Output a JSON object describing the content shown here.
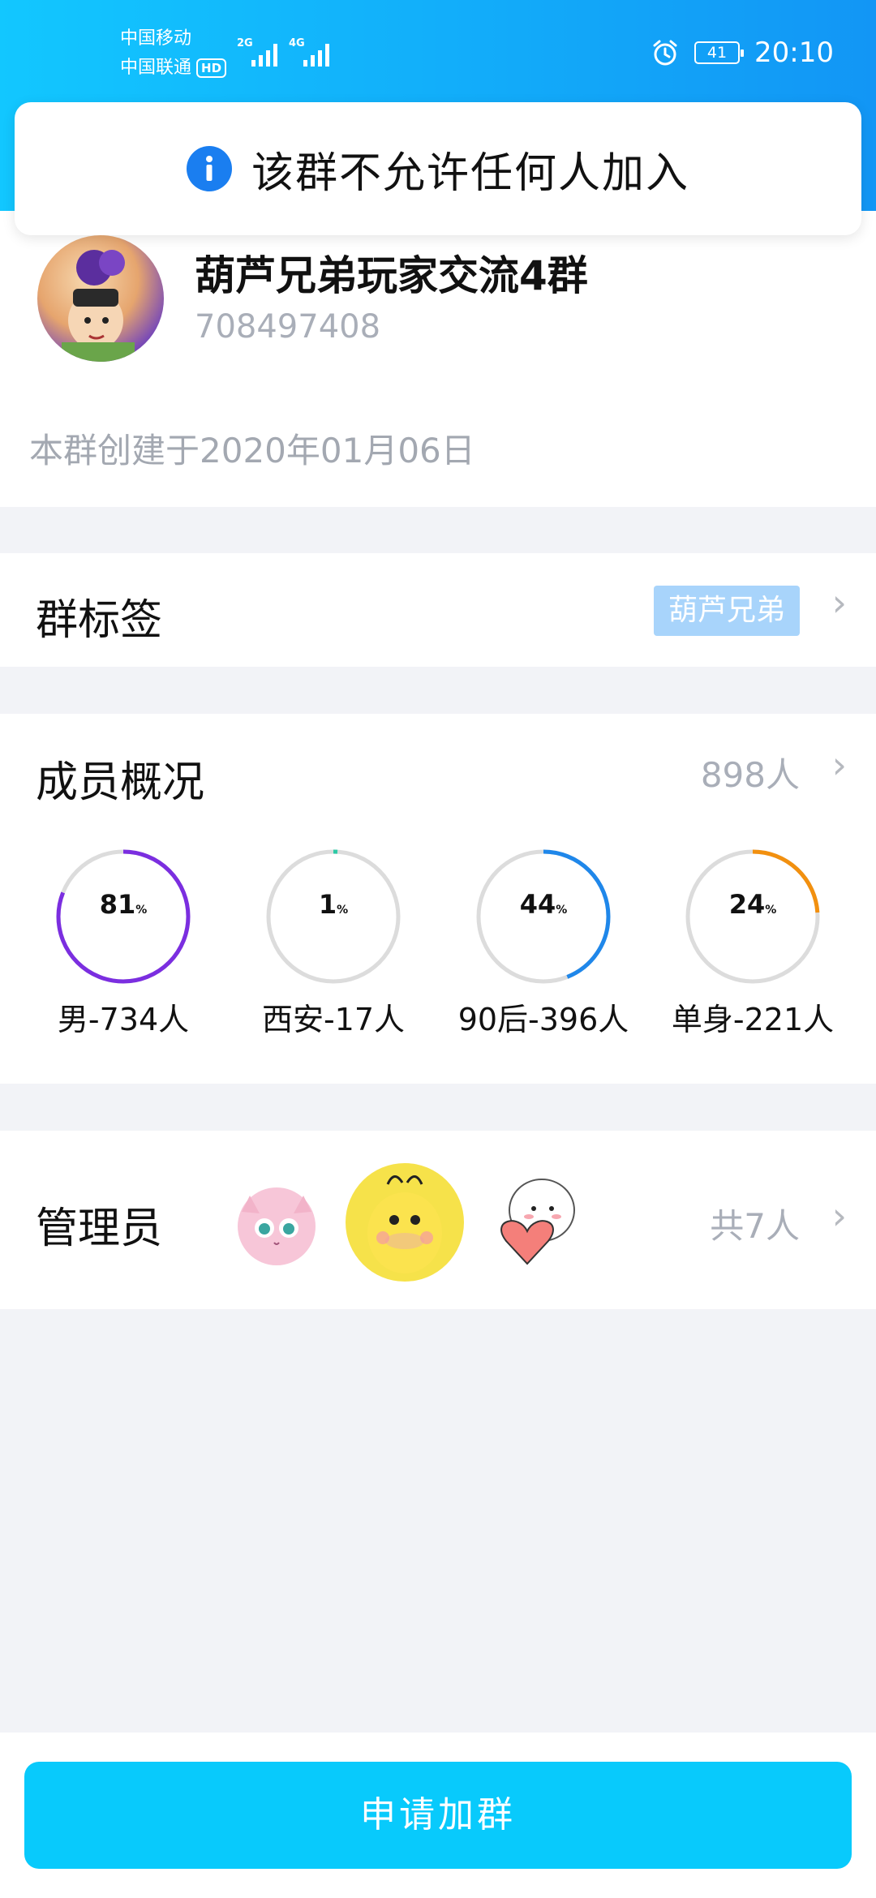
{
  "status_bar": {
    "carrier1": "中国移动",
    "carrier2": "中国联通",
    "hd_badge": "HD",
    "signal1_label": "2G",
    "signal2_label": "4G",
    "battery": "41",
    "time": "20:10"
  },
  "toast": {
    "icon": "info-icon",
    "message": "该群不允许任何人加入"
  },
  "group": {
    "name": "葫芦兄弟玩家交流4群",
    "id": "708497408",
    "created": "本群创建于2020年01月06日"
  },
  "tags": {
    "title": "群标签",
    "tag": "葫芦兄弟"
  },
  "members": {
    "title": "成员概况",
    "count": "898人",
    "stats": [
      {
        "percent": 81,
        "pct_unit": "%",
        "label": "男-734人",
        "color": "#7b2ee0"
      },
      {
        "percent": 1,
        "pct_unit": "%",
        "label": "西安-17人",
        "color": "#2cc9a5"
      },
      {
        "percent": 44,
        "pct_unit": "%",
        "label": "90后-396人",
        "color": "#1f87ea"
      },
      {
        "percent": 24,
        "pct_unit": "%",
        "label": "单身-221人",
        "color": "#f2900f"
      }
    ]
  },
  "admins": {
    "title": "管理员",
    "count": "共7人"
  },
  "colors": {
    "header_start": "#12c7ff",
    "header_end": "#1296f5",
    "button": "#08cafc",
    "tag_chip": "#a8d4fb"
  },
  "button": {
    "join": "申请加群"
  }
}
